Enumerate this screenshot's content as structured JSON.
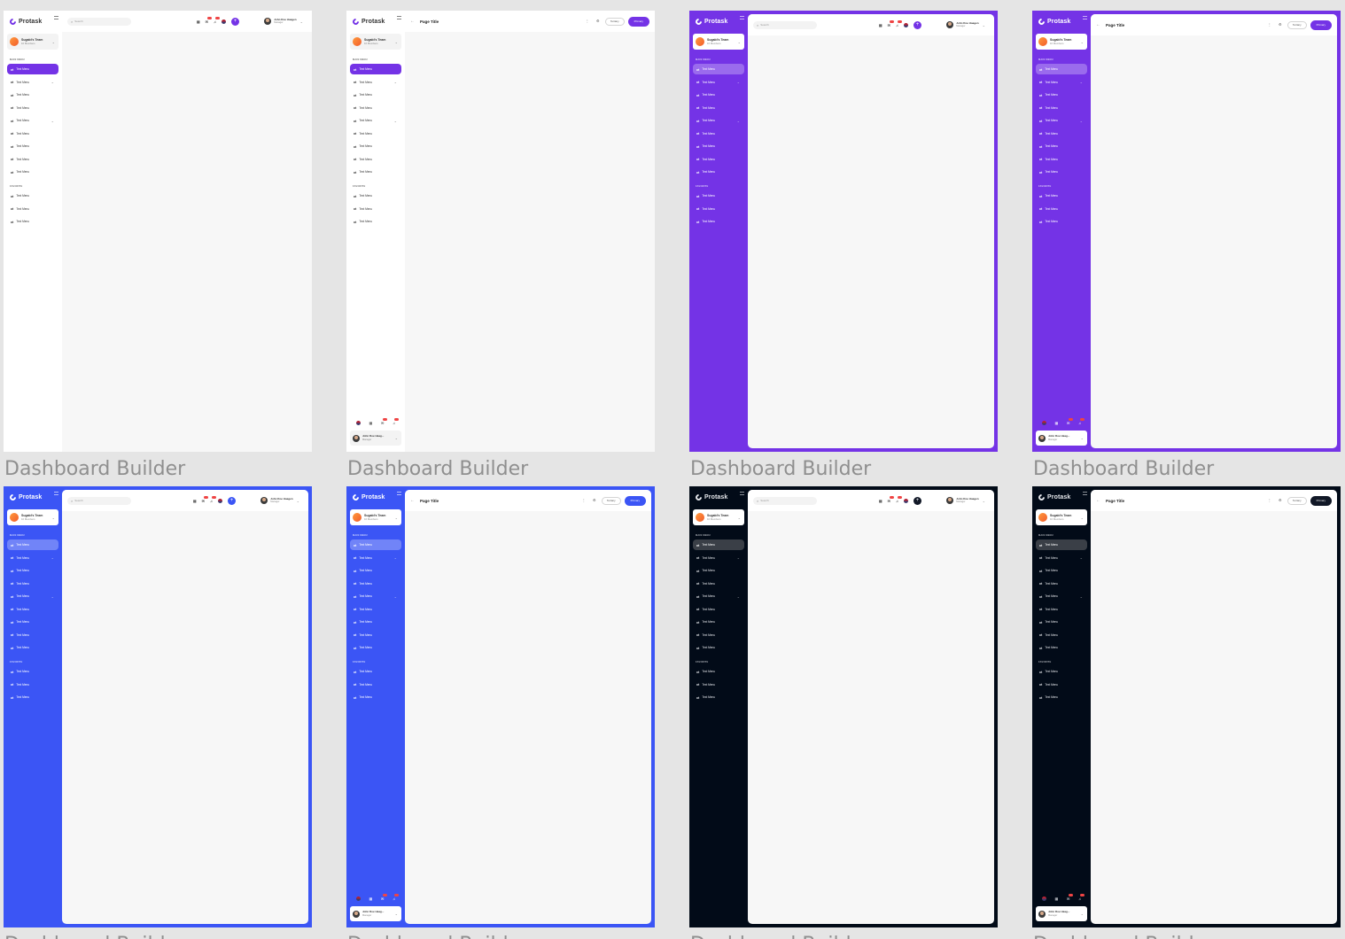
{
  "caption": "Dashboard Builder",
  "brand": "Protask",
  "team": {
    "name": "Sugabi's Team",
    "subtitle": "10 Members"
  },
  "sections": {
    "main": "MAIN MENU",
    "favorite": "FAVORITE"
  },
  "menu_label": "Text Menu",
  "search_placeholder": "Search",
  "user": {
    "name": "John Doe Haagen",
    "name_short": "John Doe Haag...",
    "role": "Manager"
  },
  "page_title": "Page Title",
  "buttons": {
    "tertiary": "Tertiary",
    "primary": "Primary"
  },
  "colors": {
    "purple": "#7433e6",
    "blue": "#3b55f5",
    "dark": "#020b18",
    "light_bg": "#f7f7f7"
  },
  "icons": [
    "logo-icon",
    "collapse-icon",
    "search-icon",
    "calendar-icon",
    "message-icon",
    "bell-icon",
    "flag-icon",
    "plus-icon",
    "back-arrow-icon",
    "more-icon",
    "settings-icon",
    "menu-item-icon",
    "chevron-down-icon"
  ]
}
